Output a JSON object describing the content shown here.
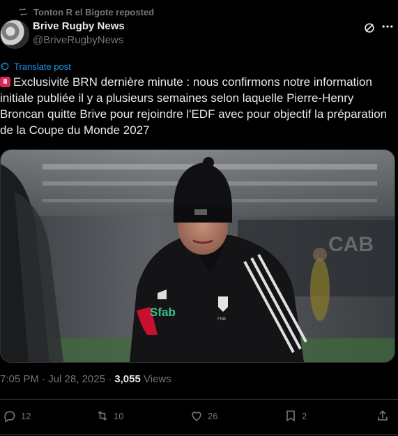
{
  "repost_label": "Tonton R el Bigote reposted",
  "author": {
    "name": "Brive Rugby News",
    "handle": "@BriveRugbyNews"
  },
  "translate_label": "Translate post",
  "post_text": "Exclusivité BRN dernière minute  : nous confirmons notre information initiale publiée il y a plusieurs semaines selon laquelle Pierre-Henry Broncan quitte Brive pour rejoindre l'EDF avec pour objectif la préparation de la Coupe du Monde 2027",
  "meta": {
    "time": "7:05 PM",
    "separator": "·",
    "date": "Jul 28, 2025",
    "views_count": "3,055",
    "views_label": "Views"
  },
  "actions": {
    "replies": "12",
    "reposts": "10",
    "likes": "26",
    "bookmarks": "2"
  },
  "image": {
    "jacket_logo_text": "Sfab",
    "badge_text": "FNB"
  },
  "icons": [
    "repost-icon",
    "grok-icon",
    "more-icon",
    "translate-icon",
    "siren-emoji",
    "reply-icon",
    "retweet-icon",
    "like-icon",
    "bookmark-icon",
    "share-icon"
  ],
  "colors": {
    "background": "#000000",
    "text": "#e7e9ea",
    "muted": "#71767b",
    "link": "#1d9bf0",
    "divider": "#2f3336"
  }
}
